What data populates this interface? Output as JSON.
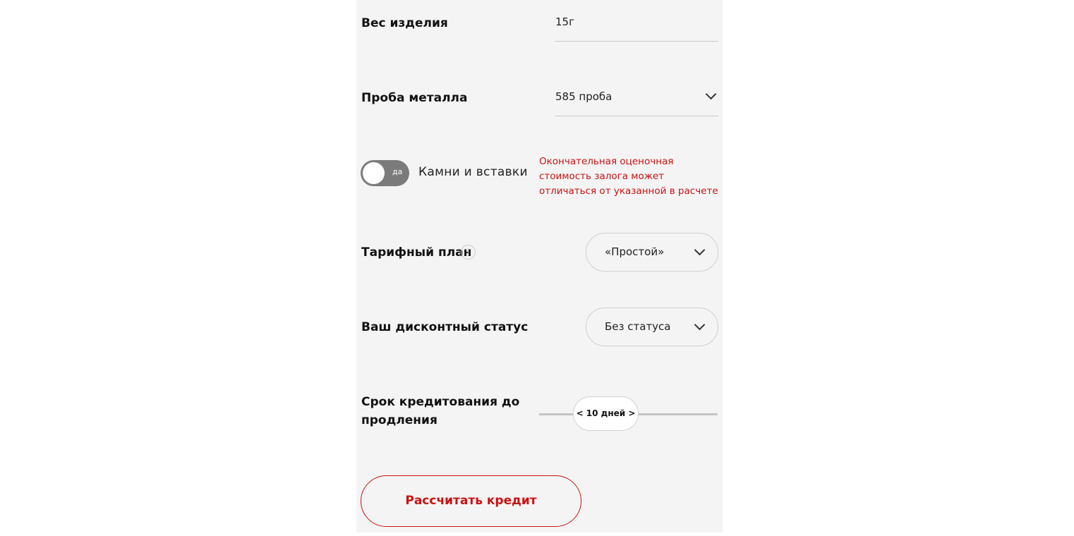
{
  "weight": {
    "label": "Вес изделия",
    "value": "15г"
  },
  "purity": {
    "label": "Проба металла",
    "value": "585 проба",
    "icon": "chevron-down-icon"
  },
  "stones": {
    "toggle_text": "да",
    "toggle_on": true,
    "label": "Камни и вставки",
    "notice": "Окончательная оценочная стоимость залога может отличаться от указанной в расчете",
    "notice_color": "#cc1111"
  },
  "tariff": {
    "label": "Тарифный план",
    "info_icon_glyph": "i",
    "value": "«Простой»"
  },
  "discount": {
    "label": "Ваш дисконтный статус",
    "value": "Без статуса"
  },
  "term": {
    "label_line1": "Срок кредитования до",
    "label_line2": "продления",
    "value": "< 10 дней >"
  },
  "actions": {
    "calculate_label": "Рассчитать кредит",
    "accent_color": "#cc1111"
  }
}
